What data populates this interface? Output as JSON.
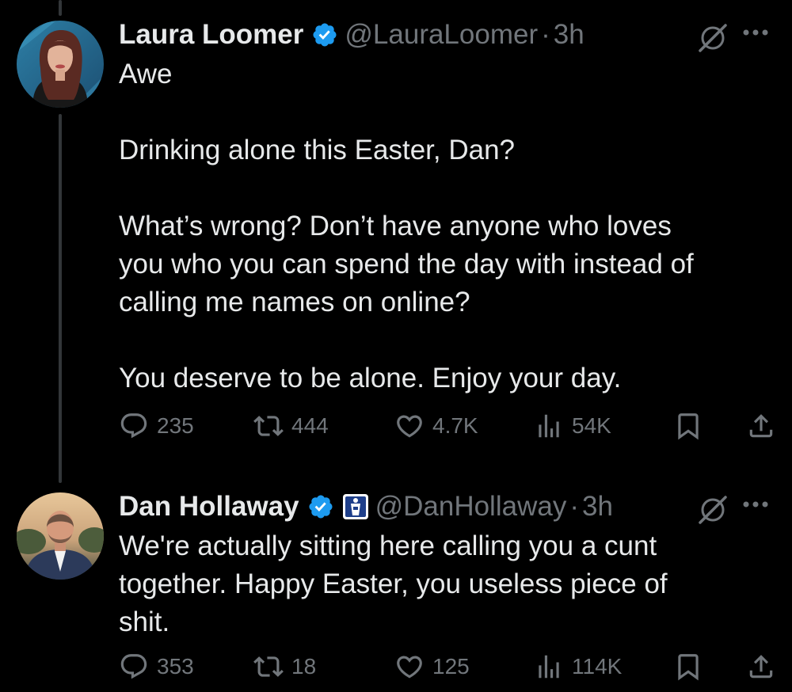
{
  "colors": {
    "background": "#000000",
    "text": "#e7e9ea",
    "secondary": "#71767b",
    "verified": "#1d9bf0",
    "thread_line": "#333639"
  },
  "tweets": [
    {
      "author": "Laura Loomer",
      "handle": "@LauraLoomer",
      "separator": "·",
      "time": "3h",
      "verified": true,
      "body": [
        "Awe",
        "",
        "Drinking alone this Easter, Dan?",
        "",
        "What’s wrong? Don’t have anyone who loves",
        "you who you can spend the day with instead of",
        "calling me names on online?",
        "",
        "You deserve to be alone. Enjoy your day."
      ],
      "stats": {
        "replies": "235",
        "reposts": "444",
        "likes": "4.7K",
        "views": "54K"
      }
    },
    {
      "author": "Dan Hollaway",
      "handle": "@DanHollaway",
      "separator": "·",
      "time": "3h",
      "verified": true,
      "affiliate_badge": "affiliate-badge-icon",
      "body": [
        "We're actually sitting here calling you a cunt",
        "together. Happy Easter, you useless piece of",
        "shit."
      ],
      "stats": {
        "replies": "353",
        "reposts": "18",
        "likes": "125",
        "views": "114K"
      }
    }
  ],
  "icons": {
    "reply": "reply-icon",
    "repost": "repost-icon",
    "like": "like-icon",
    "views": "views-icon",
    "bookmark": "bookmark-icon",
    "share": "share-icon",
    "grok": "grok-icon",
    "more": "more-icon",
    "verified": "verified-badge-icon"
  }
}
